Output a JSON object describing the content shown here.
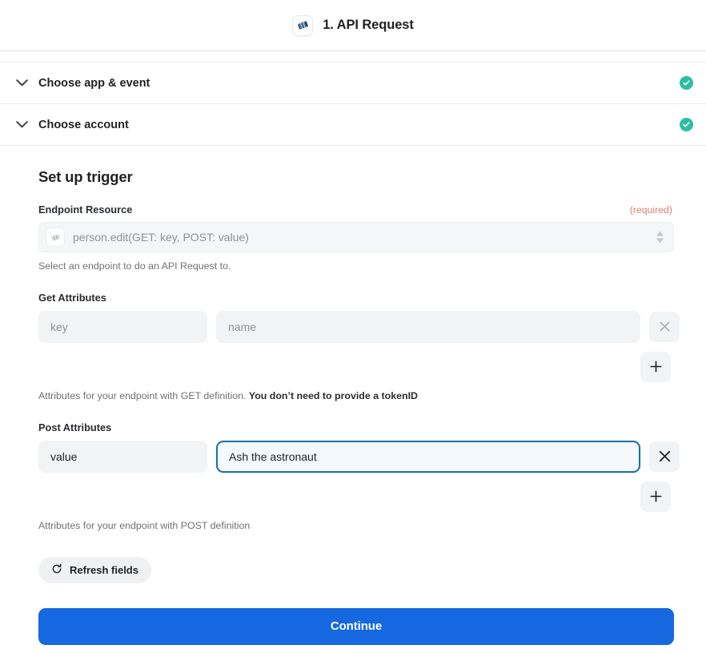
{
  "header": {
    "title": "1. API Request",
    "icon": "api-request-app-icon"
  },
  "sections": [
    {
      "label": "Choose app & event",
      "status": "complete",
      "chevron": "chevron-down-icon",
      "check": "check-circle-icon"
    },
    {
      "label": "Choose account",
      "status": "complete",
      "chevron": "chevron-down-icon",
      "check": "check-circle-icon"
    }
  ],
  "setup": {
    "title": "Set up trigger",
    "endpoint": {
      "label": "Endpoint Resource",
      "required_tag": "(required)",
      "value": "person.edit(GET: key, POST: value)",
      "help": "Select an endpoint to do an API Request to."
    },
    "get_attributes": {
      "label": "Get Attributes",
      "rows": [
        {
          "key_placeholder": "key",
          "key_value": "",
          "value_placeholder": "name",
          "value_value": ""
        }
      ],
      "help_plain": "Attributes for your endpoint with GET definition. ",
      "help_bold": "You don’t need to provide a tokenID",
      "remove_label": "×",
      "add_label": "+"
    },
    "post_attributes": {
      "label": "Post Attributes",
      "rows": [
        {
          "key_value": "value",
          "value_value": "Ash the astronaut",
          "focused": true
        }
      ],
      "help": "Attributes for your endpoint with POST definition",
      "remove_label": "×",
      "add_label": "+"
    },
    "refresh_label": "Refresh fields",
    "continue_label": "Continue"
  },
  "colors": {
    "primary": "#1568e0",
    "success": "#2bbfa0",
    "required": "#d98070",
    "focus_border": "#1f6fa8",
    "field_bg": "#f2f3f5"
  }
}
